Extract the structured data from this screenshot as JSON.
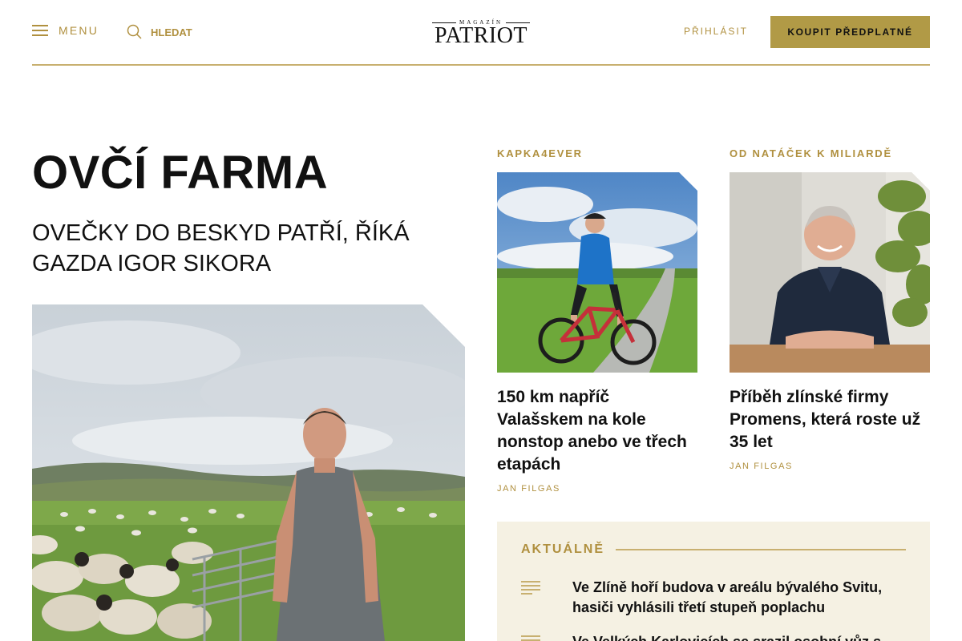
{
  "header": {
    "menu_label": "MENU",
    "search_label": "HLEDAT",
    "logo_small": "MAGAZÍN",
    "logo_main": "PATRIOT",
    "login_label": "PŘIHLÁSIT",
    "subscribe_label": "KOUPIT PŘEDPLATNÉ",
    "accent_color": "#b19a46"
  },
  "main_article": {
    "title": "OVČÍ FARMA",
    "subtitle": "OVEČKY DO BESKYD PATŘÍ, ŘÍKÁ GAZDA IGOR SIKORA"
  },
  "cards": [
    {
      "category": "KAPKA4EVER",
      "title": "150 km napříč Valašskem na kole nonstop anebo ve třech etapách",
      "author": "JAN FILGAS"
    },
    {
      "category": "OD NATÁČEK K MILIARDĚ",
      "title": "Příběh zlínské firmy Promens, která roste už 35 let",
      "author": "JAN FILGAS"
    }
  ],
  "news": {
    "heading": "AKTUÁLNĚ",
    "items": [
      "Ve Zlíně hoří budova v areálu bývalého Svitu, hasiči vyhlásili třetí stupeň poplachu",
      "Ve Velkých Karlovicích se srazil osobní vůz s motocyklem"
    ]
  }
}
